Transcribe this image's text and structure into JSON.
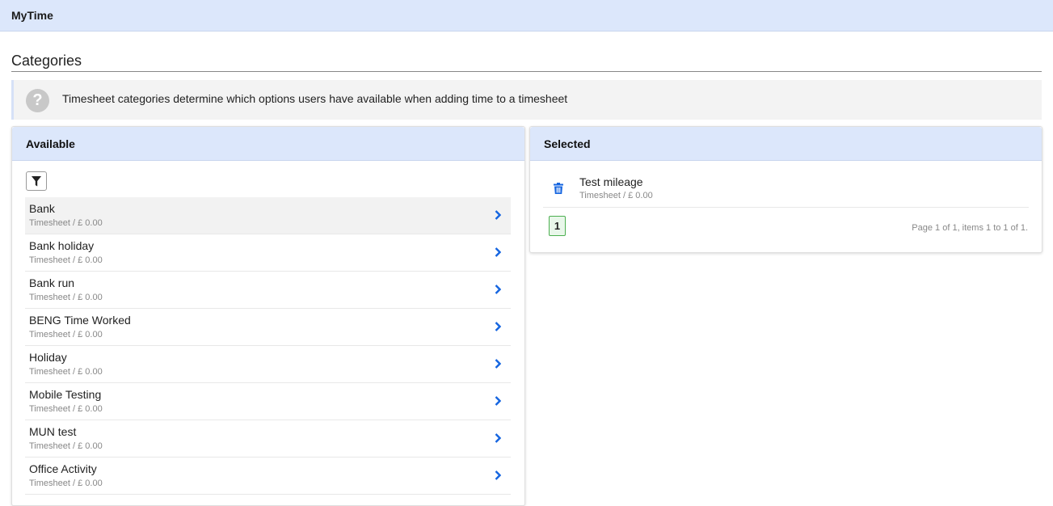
{
  "app": {
    "title": "MyTime"
  },
  "page": {
    "title": "Categories"
  },
  "info": {
    "text": "Timesheet categories determine which options users have available when adding time to a timesheet"
  },
  "available": {
    "header": "Available",
    "items": [
      {
        "name": "Bank",
        "meta": "Timesheet  /  £ 0.00"
      },
      {
        "name": "Bank holiday",
        "meta": "Timesheet  /  £ 0.00"
      },
      {
        "name": "Bank run",
        "meta": "Timesheet  /  £ 0.00"
      },
      {
        "name": "BENG Time Worked",
        "meta": "Timesheet  /  £ 0.00"
      },
      {
        "name": "Holiday",
        "meta": "Timesheet  /  £ 0.00"
      },
      {
        "name": "Mobile Testing",
        "meta": "Timesheet  /  £ 0.00"
      },
      {
        "name": "MUN test",
        "meta": "Timesheet  /  £ 0.00"
      },
      {
        "name": "Office Activity",
        "meta": "Timesheet  /  £ 0.00"
      }
    ]
  },
  "selected": {
    "header": "Selected",
    "items": [
      {
        "name": "Test mileage",
        "meta": "Timesheet  /  £ 0.00"
      }
    ],
    "pager": {
      "current_page": "1",
      "summary": "Page 1 of 1, items 1 to 1 of 1."
    }
  },
  "colors": {
    "header_bg": "#dce7fb",
    "accent": "#1565e0",
    "pager_border": "#4caf50"
  }
}
